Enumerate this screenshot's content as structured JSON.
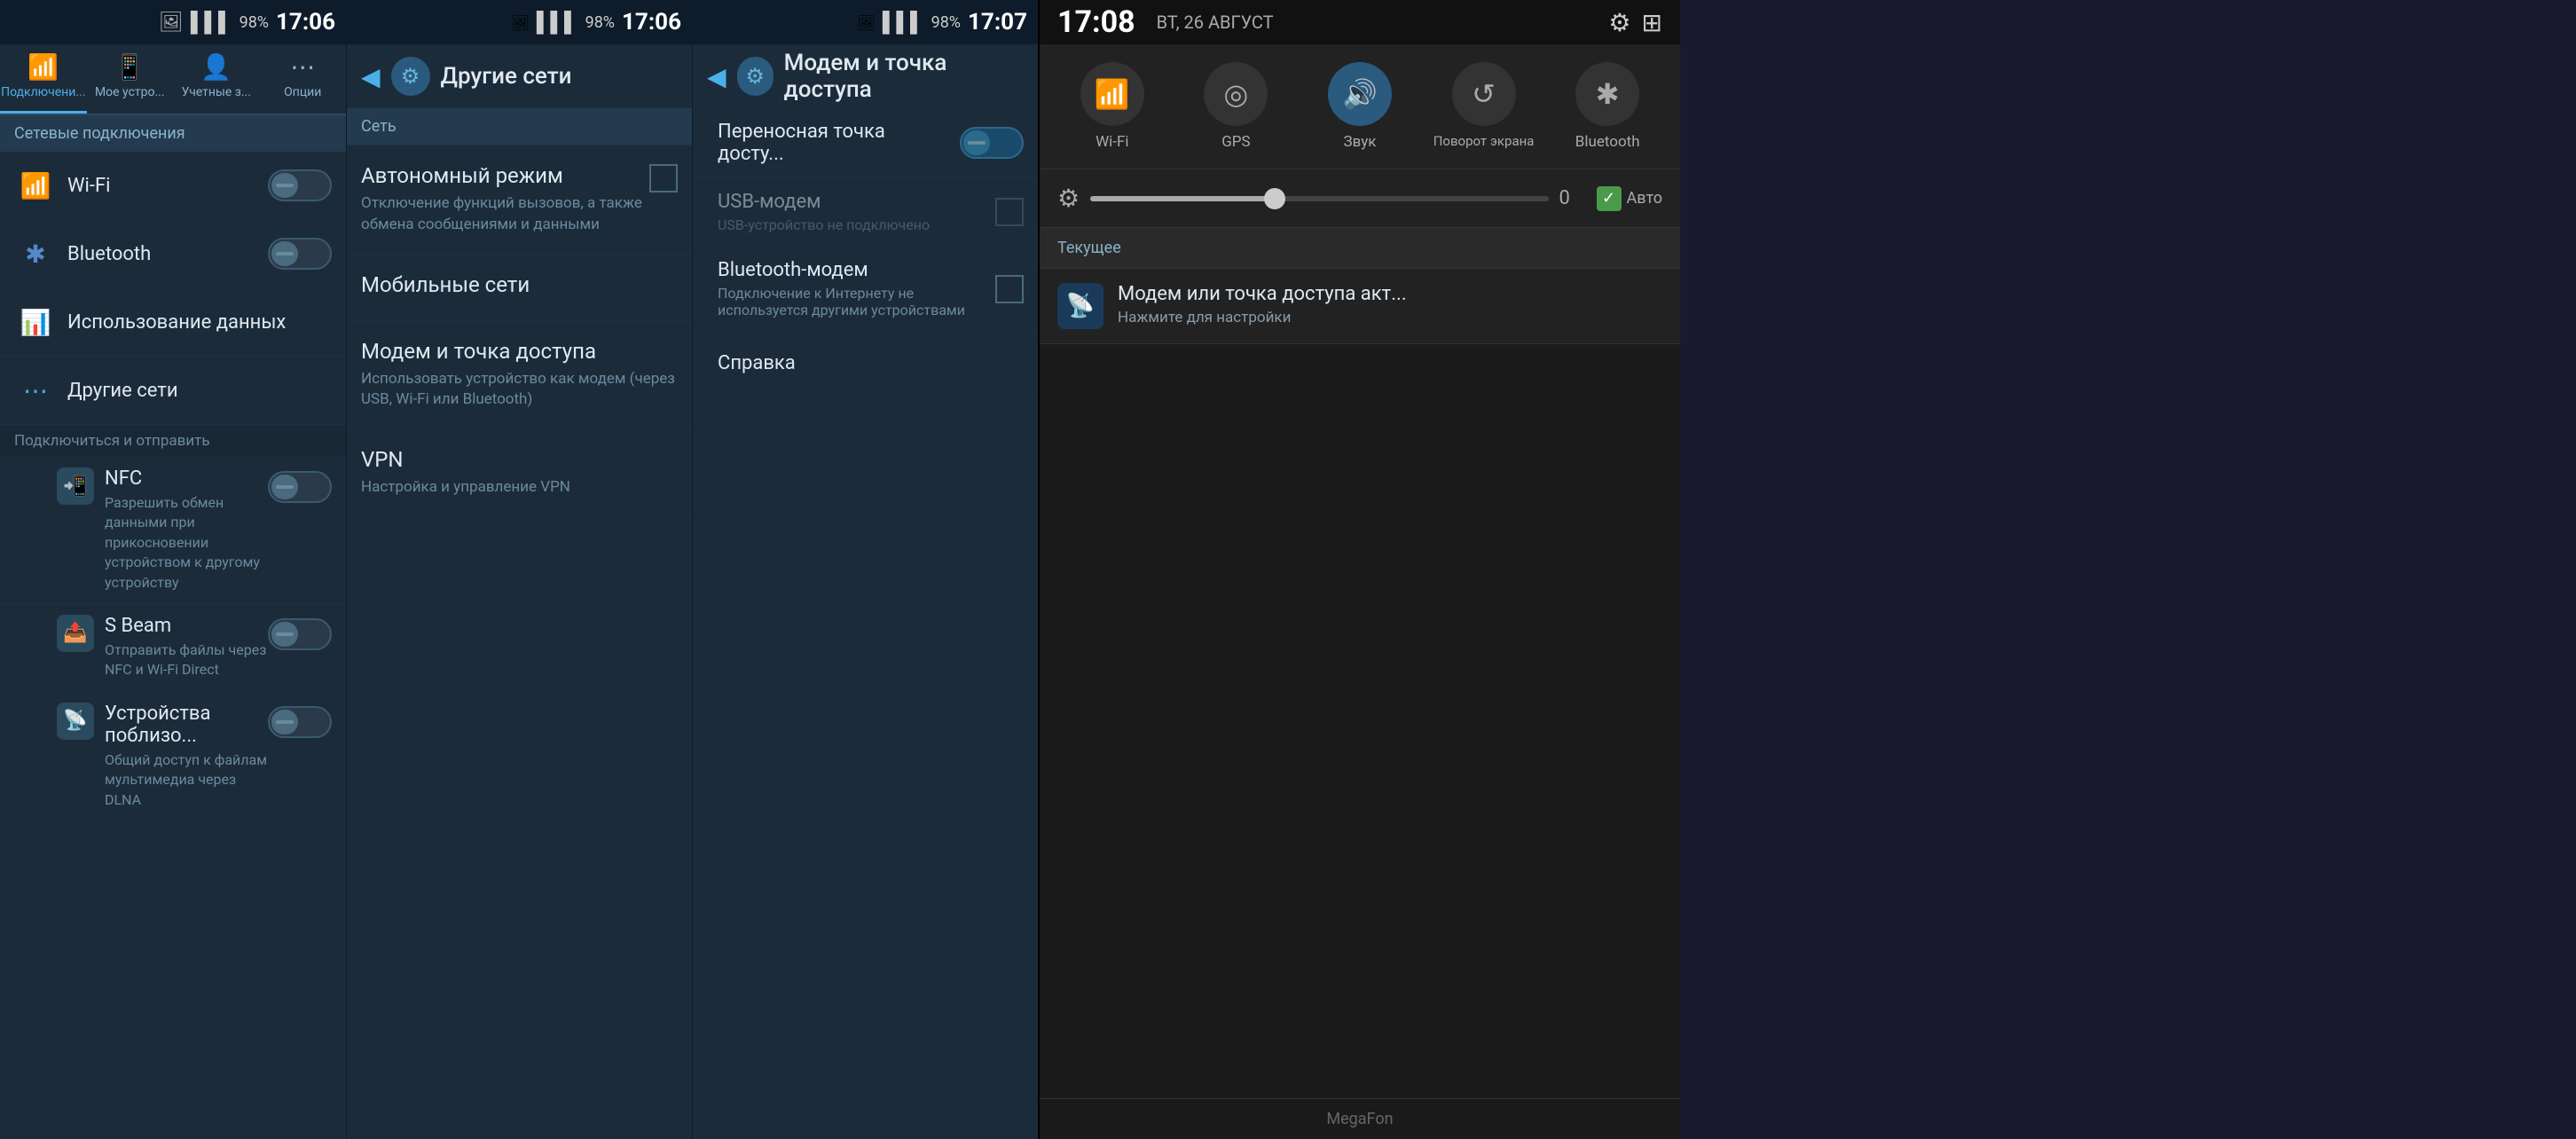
{
  "panel1": {
    "status_bar": {
      "signal": "▌▌▌",
      "battery_percent": "98%",
      "time": "17:06",
      "img_icon": "🖼"
    },
    "tabs": [
      {
        "id": "connections",
        "label": "Подключени...",
        "icon": "📶",
        "active": true
      },
      {
        "id": "device",
        "label": "Мое устро...",
        "icon": "📱",
        "active": false
      },
      {
        "id": "accounts",
        "label": "Учетные з...",
        "icon": "👤",
        "active": false
      },
      {
        "id": "options",
        "label": "Опции",
        "icon": "⋯",
        "active": false
      }
    ],
    "section1_label": "Сетевые подключения",
    "items": [
      {
        "icon": "📶",
        "title": "Wi-Fi",
        "toggle": false
      },
      {
        "icon": "🔷",
        "title": "Bluetooth",
        "toggle": false
      }
    ],
    "data_usage": {
      "icon": "📊",
      "title": "Использование данных"
    },
    "other_networks": {
      "icon": "⋯",
      "title": "Другие сети"
    },
    "section2_label": "Подключиться и отправить",
    "sub_items": [
      {
        "icon": "📲",
        "title": "NFC",
        "desc": "Разрешить обмен данными при прикосновении устройством к другому устройству",
        "toggle": false
      },
      {
        "icon": "📤",
        "title": "S Beam",
        "desc": "Отправить файлы через NFC и Wi-Fi Direct",
        "toggle": false
      },
      {
        "icon": "📡",
        "title": "Устройства поблизо...",
        "desc": "Общий доступ к файлам мультимедиа через DLNA",
        "toggle": false
      }
    ]
  },
  "panel2": {
    "status_bar": {
      "signal": "▌▌▌",
      "battery_percent": "98%",
      "time": "17:06",
      "img_icon": "🖼"
    },
    "header": {
      "back_label": "◀",
      "title": "Другие сети"
    },
    "section_label": "Сеть",
    "items": [
      {
        "title": "Автономный режим",
        "desc": "Отключение функций вызовов, а также обмена сообщениями и данными",
        "has_checkbox": true
      },
      {
        "title": "Мобильные сети",
        "desc": "",
        "has_checkbox": false
      },
      {
        "title": "Модем и точка доступа",
        "desc": "Использовать устройство как модем (через USB, Wi-Fi или Bluetooth)",
        "has_checkbox": false
      },
      {
        "title": "VPN",
        "desc": "Настройка и управление VPN",
        "has_checkbox": false
      }
    ]
  },
  "panel3": {
    "status_bar": {
      "signal": "▌▌▌",
      "battery_percent": "98%",
      "time": "17:07",
      "img_icon": "🖼"
    },
    "header": {
      "back_label": "◀",
      "title": "Модем и точка доступа"
    },
    "items": [
      {
        "title": "Переносная точка досту...",
        "desc": "",
        "toggle": true,
        "toggle_on": false
      },
      {
        "title": "USB-модем",
        "desc": "USB-устройство не подключено",
        "has_checkbox": true,
        "disabled": true
      },
      {
        "title": "Bluetooth-модем",
        "desc": "Подключение к Интернету не используется другими устройствами",
        "has_checkbox": true
      },
      {
        "title": "Справка",
        "desc": ""
      }
    ]
  },
  "panel4": {
    "status_bar": {
      "time": "17:08",
      "date": "ВТ, 26 АВГУСТ"
    },
    "top_icons": [
      {
        "name": "settings-icon",
        "icon": "⚙"
      },
      {
        "name": "grid-icon",
        "icon": "⊞"
      }
    ],
    "quick_toggles": [
      {
        "id": "wifi",
        "icon": "📶",
        "label": "Wi-Fi",
        "active": false
      },
      {
        "id": "gps",
        "icon": "◎",
        "label": "GPS",
        "active": false
      },
      {
        "id": "sound",
        "icon": "🔊",
        "label": "Звук",
        "active": true
      },
      {
        "id": "rotate",
        "icon": "↺",
        "label": "Поворот экрана",
        "active": false
      },
      {
        "id": "bluetooth",
        "icon": "✱",
        "label": "Bluetooth",
        "active": false
      }
    ],
    "brightness": {
      "icon": "☀",
      "value": "0",
      "auto_label": "Авто",
      "auto_checked": true
    },
    "current_section_label": "Текущее",
    "notifications": [
      {
        "icon": "📡",
        "title": "Модем или точка доступа акт...",
        "desc": "Нажмите для настройки"
      }
    ],
    "carrier": "MegaFon"
  }
}
